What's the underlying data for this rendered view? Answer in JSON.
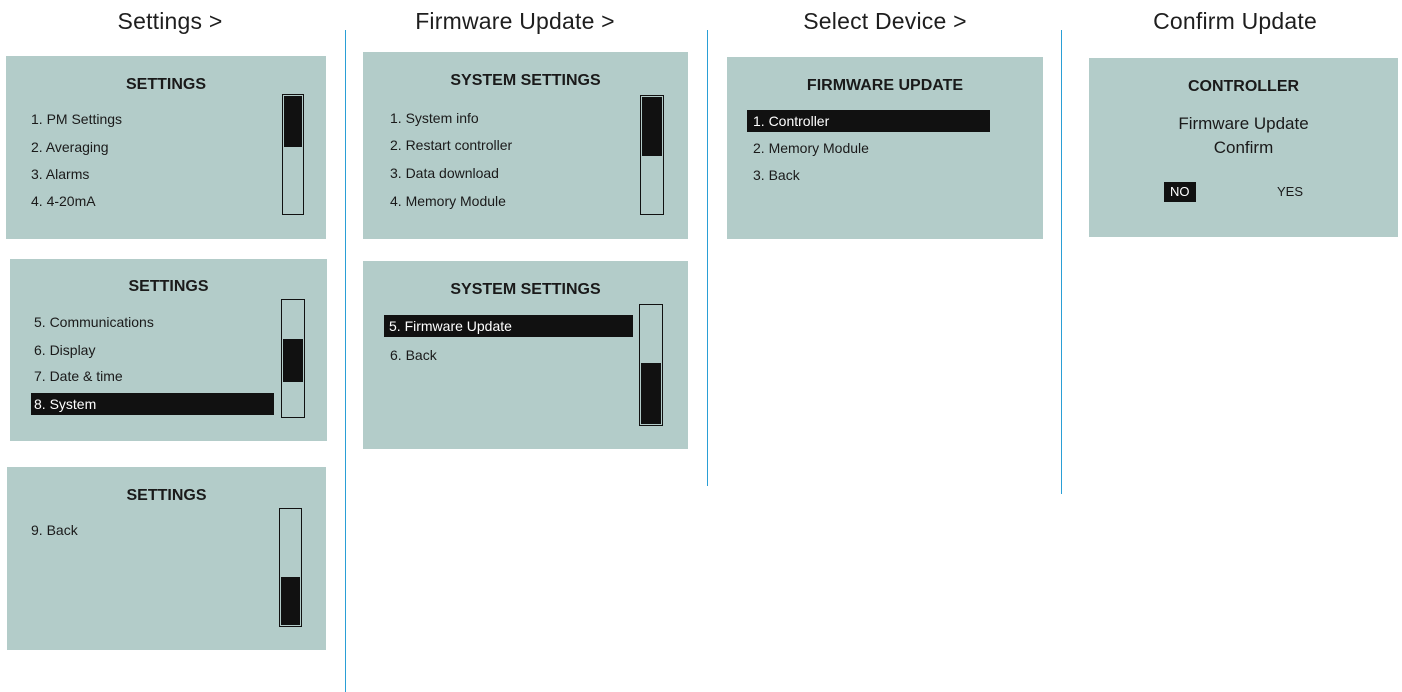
{
  "columns": [
    {
      "title": "Settings >"
    },
    {
      "title": "Firmware Update >"
    },
    {
      "title": "Select Device >"
    },
    {
      "title": "Confirm Update"
    }
  ],
  "settings_panels": [
    {
      "title": "SETTINGS",
      "items": [
        "1. PM Settings",
        "2. Averaging",
        "3. Alarms",
        "4. 4-20mA"
      ],
      "selected_index": -1,
      "scroll_position": 0.0
    },
    {
      "title": "SETTINGS",
      "items": [
        "5. Communications",
        "6. Display",
        "7. Date & time",
        "8. System"
      ],
      "selected_index": 3,
      "scroll_position": 0.5
    },
    {
      "title": "SETTINGS",
      "items": [
        "9. Back"
      ],
      "selected_index": -1,
      "scroll_position": 1.0
    }
  ],
  "system_panels": [
    {
      "title": "SYSTEM SETTINGS",
      "items": [
        "1.  System info",
        "2. Restart controller",
        "3. Data download",
        "4. Memory Module"
      ],
      "selected_index": -1,
      "scroll_position": 0.0
    },
    {
      "title": "SYSTEM SETTINGS",
      "items": [
        "5.  Firmware Update",
        "6. Back"
      ],
      "selected_index": 0,
      "scroll_position": 1.0
    }
  ],
  "firmware_panel": {
    "title": "FIRMWARE UPDATE",
    "items": [
      "1.  Controller",
      "2. Memory Module",
      "3. Back"
    ],
    "selected_index": 0
  },
  "confirm_panel": {
    "title": "CONTROLLER",
    "line1": "Firmware Update",
    "line2": "Confirm",
    "no_label": "NO",
    "yes_label": "YES",
    "selected": "NO"
  },
  "colors": {
    "panel_bg": "#b3ccc9",
    "highlight": "#111111",
    "divider": "#2a9fd6"
  }
}
